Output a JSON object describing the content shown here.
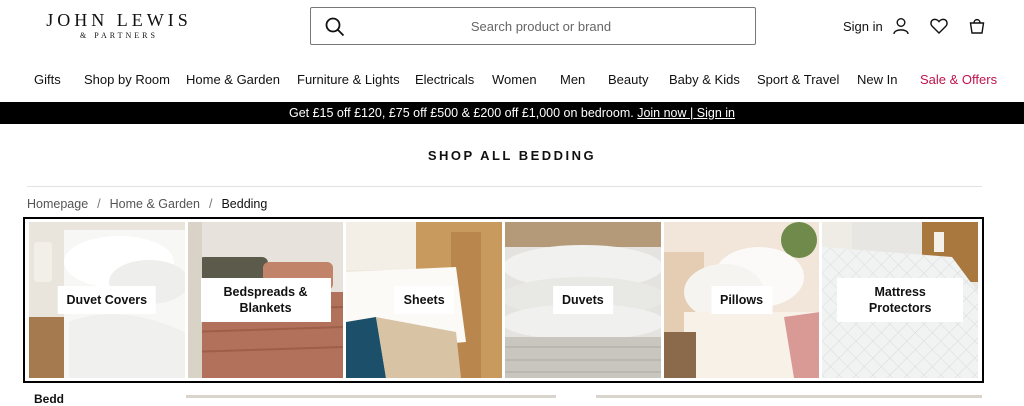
{
  "brand": {
    "name": "JOHN LEWIS",
    "sub": "& PARTNERS"
  },
  "search": {
    "placeholder": "Search product or brand"
  },
  "header_actions": {
    "sign_in": "Sign in"
  },
  "nav": [
    "Gifts",
    "Shop by Room",
    "Home & Garden",
    "Furniture & Lights",
    "Electricals",
    "Women",
    "Men",
    "Beauty",
    "Baby & Kids",
    "Sport & Travel",
    "New In",
    "Sale & Offers"
  ],
  "promo": {
    "text": "Get £15 off £120, £75 off £500 & £200 off £1,000 on bedroom.",
    "join": "Join now",
    "sep": "|",
    "sign_in": "Sign in"
  },
  "page": {
    "title": "SHOP ALL BEDDING"
  },
  "breadcrumb": [
    "Homepage",
    "Home & Garden",
    "Bedding"
  ],
  "categories": [
    "Duvet Covers",
    "Bedspreads & Blankets",
    "Sheets",
    "Duvets",
    "Pillows",
    "Mattress Protectors"
  ],
  "below": {
    "heading": "Bedd"
  },
  "colors": {
    "sale": "#c0134b",
    "promo_bg": "#000000"
  }
}
